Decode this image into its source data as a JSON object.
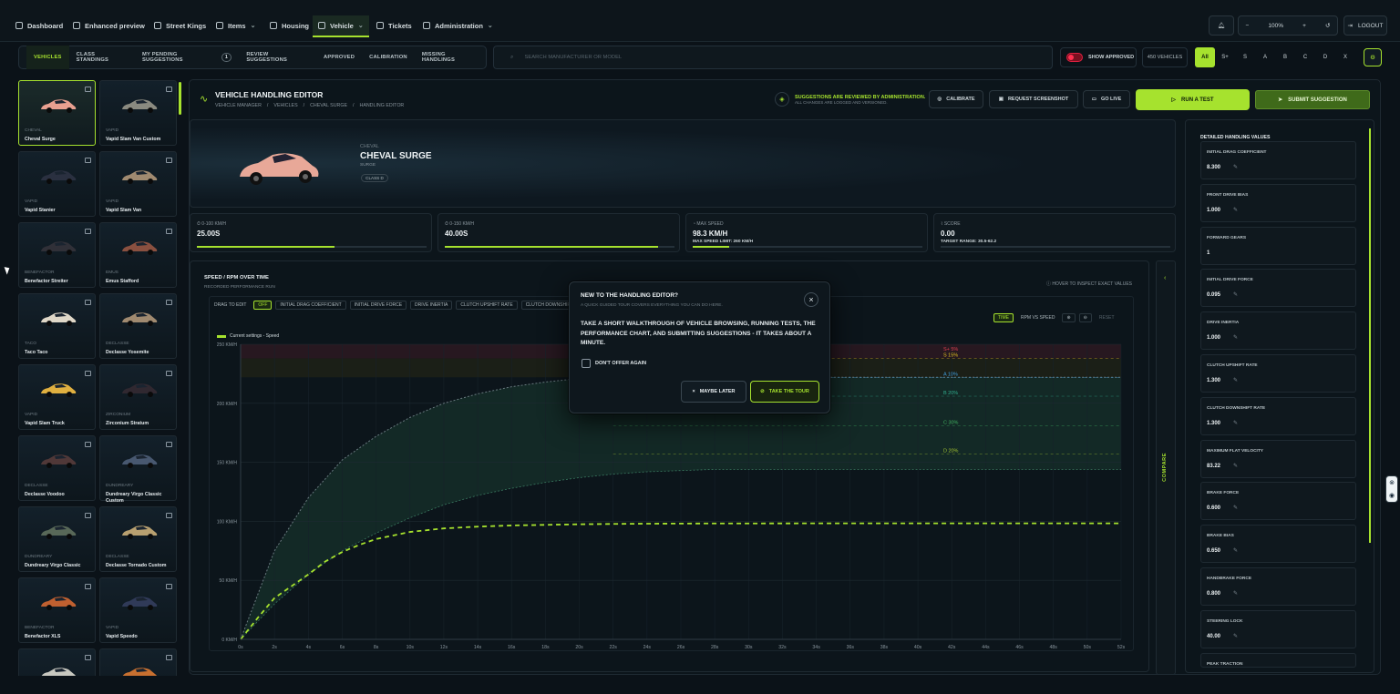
{
  "nav": {
    "items": [
      {
        "label": "Dashboard",
        "icon": "chart-icon"
      },
      {
        "label": "Enhanced preview",
        "icon": "camera-icon"
      },
      {
        "label": "Street Kings",
        "icon": "flag-icon"
      },
      {
        "label": "Items",
        "icon": "box-icon"
      },
      {
        "label": "Housing",
        "icon": "house-icon"
      },
      {
        "label": "Vehicle",
        "icon": "car-icon"
      },
      {
        "label": "Tickets",
        "icon": "ticket-icon"
      },
      {
        "label": "Administration",
        "icon": "gear-icon"
      }
    ],
    "zoom": "100%",
    "logout": "LOGOUT"
  },
  "subnav": {
    "tabs": [
      "VEHICLES",
      "CLASS STANDINGS",
      "MY PENDING SUGGESTIONS",
      "REVIEW SUGGESTIONS",
      "APPROVED",
      "CALIBRATION",
      "MISSING HANDLINGS"
    ],
    "pending_count": "1"
  },
  "search": {
    "placeholder": "SEARCH MANUFACTURER OR MODEL"
  },
  "filters": {
    "show_approved": "SHOW APPROVED",
    "vehicle_count": "450 VEHICLES",
    "classes": [
      "All",
      "S+",
      "S",
      "A",
      "B",
      "C",
      "D",
      "X"
    ]
  },
  "vehicles": [
    {
      "make": "CHEVAL",
      "name": "Cheval Surge",
      "color": "#e8a090"
    },
    {
      "make": "VAPID",
      "name": "Vapid Slam Van Custom",
      "color": "#8a8a80"
    },
    {
      "make": "VAPID",
      "name": "Vapid Stanier",
      "color": "#2a3040"
    },
    {
      "make": "VAPID",
      "name": "Vapid Slam Van",
      "color": "#a08a70"
    },
    {
      "make": "BENEFACTOR",
      "name": "Benefactor Streiter",
      "color": "#303038"
    },
    {
      "make": "EMUS",
      "name": "Emus Stafford",
      "color": "#8a5040"
    },
    {
      "make": "TACO",
      "name": "Taco Taco",
      "color": "#e0d8c8"
    },
    {
      "make": "DECLASSE",
      "name": "Declasse Yosemite",
      "color": "#a08a70"
    },
    {
      "make": "VAPID",
      "name": "Vapid Slam Truck",
      "color": "#e0b040"
    },
    {
      "make": "ZIRCONIUM",
      "name": "Zirconium Stratum",
      "color": "#302830"
    },
    {
      "make": "DECLASSE",
      "name": "Declasse Voodoo",
      "color": "#503838"
    },
    {
      "make": "DUNDREARY",
      "name": "Dundreary Virgo Classic Custom",
      "color": "#485870"
    },
    {
      "make": "DUNDREARY",
      "name": "Dundreary Virgo Classic",
      "color": "#586858"
    },
    {
      "make": "DECLASSE",
      "name": "Declasse Tornado Custom",
      "color": "#b8a070"
    },
    {
      "make": "BENEFACTOR",
      "name": "Benefactor XLS",
      "color": "#c06030"
    },
    {
      "make": "VAPID",
      "name": "Vapid Speedo",
      "color": "#303a58"
    },
    {
      "make": "",
      "name": "",
      "color": "#c8c8c0"
    },
    {
      "make": "",
      "name": "",
      "color": "#c87030"
    }
  ],
  "header": {
    "title": "VEHICLE HANDLING EDITOR",
    "breadcrumb": [
      "VEHICLE MANAGER",
      "/",
      "VEHICLES",
      "/",
      "CHEVAL SURGE",
      "/",
      "HANDLING EDITOR"
    ],
    "notice_line1": "SUGGESTIONS ARE REVIEWED BY ADMINISTRATION.",
    "notice_line2": "ALL CHANGES ARE LOGGED AND VERSIONED.",
    "calibrate": "CALIBRATE",
    "request_screenshot": "REQUEST SCREENSHOT",
    "go_live": "GO LIVE",
    "run_test": "RUN A TEST",
    "submit": "SUBMIT SUGGESTION"
  },
  "hero": {
    "make": "CHEVAL",
    "name": "CHEVAL SURGE",
    "model": "SURGE",
    "class": "CLASS D"
  },
  "stats": [
    {
      "label": "0-100 KM/H",
      "value": "25.00S",
      "sub": "",
      "progress": 0.6
    },
    {
      "label": "0-150 KM/H",
      "value": "40.00S",
      "sub": "",
      "progress": 0.93
    },
    {
      "label": "MAX SPEED",
      "value": "98.3 KM/H",
      "sub": "MAX SPEED LIMIT: 260 KM/H",
      "progress": 0.16
    },
    {
      "label": "SCORE",
      "value": "0.00",
      "sub": "TARGET RANGE: 30.5-62.2",
      "progress": 0
    }
  ],
  "chart_panel": {
    "title": "SPEED / RPM OVER TIME",
    "subtitle": "RECORDED PERFORMANCE RUN",
    "hover_hint": "HOVER TO INSPECT EXACT VALUES",
    "drag_label": "DRAG TO EDIT",
    "drag_state": "OFF",
    "drag_chips": [
      "INITIAL DRAG COEFFICIENT",
      "INITIAL DRIVE FORCE",
      "DRIVE INERTIA",
      "CLUTCH UPSHIFT RATE",
      "CLUTCH DOWNSHIFT RATE"
    ],
    "view_time": "TIME",
    "view_rpm": "RPM VS SPEED",
    "reset": "RESET",
    "compare": "COMPARE"
  },
  "chart_data": {
    "type": "line",
    "title": "SPEED / RPM OVER TIME",
    "xlabel": "",
    "ylabel": "",
    "x_ticks": [
      "0s",
      "2s",
      "4s",
      "6s",
      "8s",
      "10s",
      "12s",
      "14s",
      "16s",
      "18s",
      "20s",
      "22s",
      "24s",
      "26s",
      "28s",
      "30s",
      "32s",
      "34s",
      "36s",
      "38s",
      "40s",
      "42s",
      "44s",
      "46s",
      "48s",
      "50s",
      "52s"
    ],
    "y_ticks": [
      "0 KM/H",
      "50 KM/H",
      "100 KM/H",
      "150 KM/H",
      "200 KM/H",
      "250 KM/H"
    ],
    "xlim": [
      0,
      52
    ],
    "ylim": [
      0,
      250
    ],
    "grid": true,
    "series": [
      {
        "name": "Current settings - Speed",
        "color": "#a6e22e",
        "style": "dashed",
        "x": [
          0,
          1,
          2,
          3,
          4,
          5,
          6,
          7,
          8,
          9,
          10,
          12,
          14,
          16,
          18,
          20,
          22,
          24,
          26,
          28,
          30,
          35,
          40,
          45,
          50,
          52
        ],
        "y": [
          0,
          18,
          35,
          45,
          55,
          66,
          74,
          80,
          85,
          88,
          91,
          94,
          95.5,
          96.5,
          97,
          97.5,
          97.8,
          98,
          98.1,
          98.2,
          98.2,
          98.3,
          98.3,
          98.3,
          98.3,
          98.3
        ]
      }
    ],
    "bands": [
      {
        "label": "S+ 5%",
        "color": "#e04050",
        "upper_x": [
          0,
          2,
          4,
          6,
          8,
          10,
          12,
          14,
          16,
          18,
          20,
          22,
          24,
          26,
          28,
          30,
          35,
          40,
          45,
          52
        ],
        "upper_y": [
          0,
          75,
          120,
          152,
          172,
          188,
          200,
          208,
          214,
          218,
          221,
          222,
          222,
          222,
          222,
          222,
          222,
          222,
          222,
          222
        ],
        "top": 250
      },
      {
        "label": "S 15%",
        "color": "#e0c020",
        "level": 238
      },
      {
        "label": "A 10%",
        "color": "#40a0e0",
        "level": 222
      },
      {
        "label": "B 20%",
        "color": "#30b090",
        "level": 206
      },
      {
        "label": "C 30%",
        "color": "#40b060",
        "level": 181
      },
      {
        "label": "D 20%",
        "color": "#a0c030",
        "level": 157
      }
    ],
    "band_lower": {
      "x": [
        0,
        2,
        4,
        6,
        8,
        10,
        12,
        14,
        16,
        18,
        20,
        22,
        24,
        26,
        28,
        30,
        35,
        40,
        45,
        52
      ],
      "y": [
        0,
        30,
        55,
        75,
        90,
        103,
        114,
        122,
        128,
        133,
        137,
        140,
        142,
        143,
        144,
        144,
        144,
        144,
        144,
        144
      ]
    }
  },
  "handling": {
    "title": "DETAILED HANDLING VALUES",
    "items": [
      {
        "name": "INITIAL DRAG COEFFICIENT",
        "value": "8.300",
        "editable": true
      },
      {
        "name": "FRONT DRIVE BIAS",
        "value": "1.000",
        "editable": true
      },
      {
        "name": "FORWARD GEARS",
        "value": "1",
        "editable": false
      },
      {
        "name": "INITIAL DRIVE FORCE",
        "value": "0.095",
        "editable": true
      },
      {
        "name": "DRIVE INERTIA",
        "value": "1.000",
        "editable": true
      },
      {
        "name": "CLUTCH UPSHIFT RATE",
        "value": "1.300",
        "editable": true
      },
      {
        "name": "CLUTCH DOWNSHIFT RATE",
        "value": "1.300",
        "editable": true
      },
      {
        "name": "MAXIMUM FLAT VELOCITY",
        "value": "83.22",
        "editable": true
      },
      {
        "name": "BRAKE FORCE",
        "value": "0.600",
        "editable": true
      },
      {
        "name": "BRAKE BIAS",
        "value": "0.650",
        "editable": true
      },
      {
        "name": "HANDBRAKE FORCE",
        "value": "0.800",
        "editable": true
      },
      {
        "name": "STEERING LOCK",
        "value": "40.00",
        "editable": true
      },
      {
        "name": "PEAK TRACTION",
        "value": "",
        "editable": false
      }
    ]
  },
  "modal": {
    "title": "NEW TO THE HANDLING EDITOR?",
    "subtitle": "A QUICK GUIDED TOUR COVERS EVERYTHING YOU CAN DO HERE.",
    "body": "TAKE A SHORT WALKTHROUGH OF VEHICLE BROWSING, RUNNING TESTS, THE PERFORMANCE CHART, AND SUBMITTING SUGGESTIONS - IT TAKES ABOUT A MINUTE.",
    "checkbox": "DON'T OFFER AGAIN",
    "later": "MAYBE LATER",
    "tour": "TAKE THE TOUR"
  }
}
